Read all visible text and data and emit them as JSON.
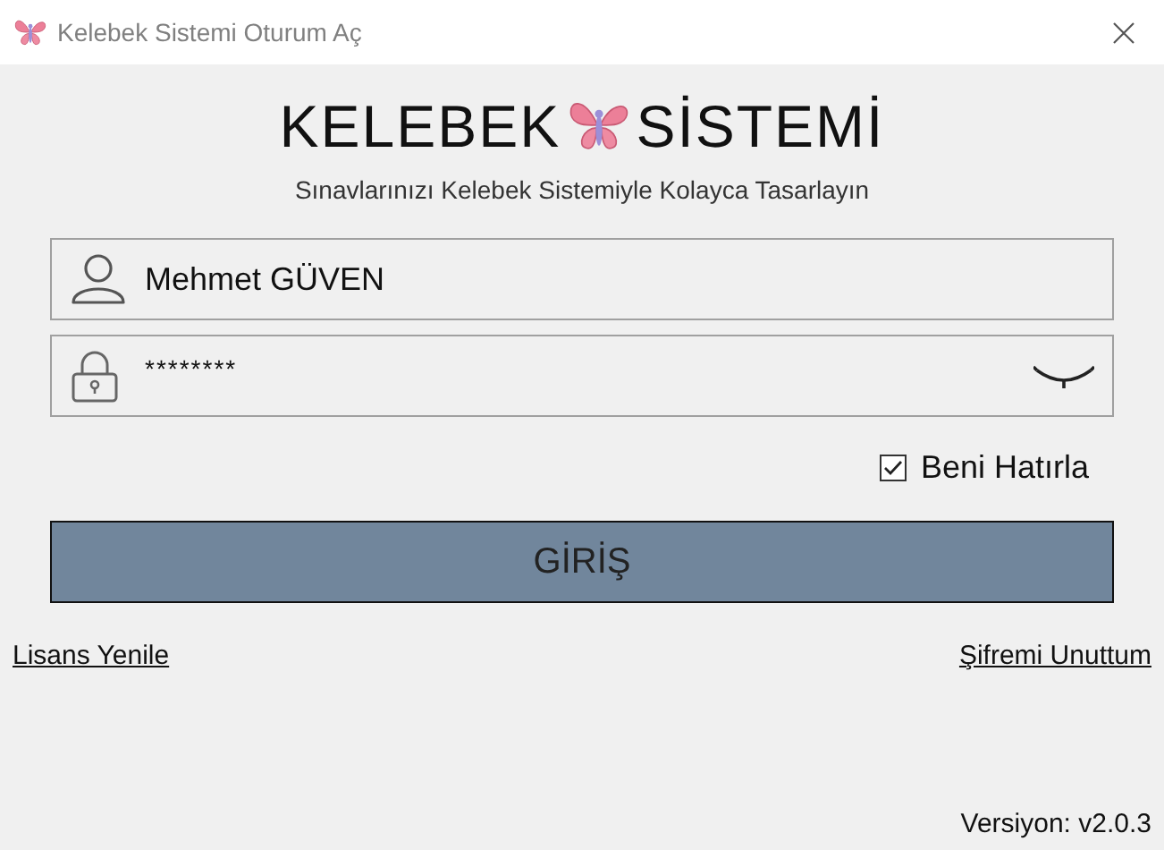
{
  "window": {
    "title": "Kelebek Sistemi Oturum Aç"
  },
  "logo": {
    "left": "KELEBEK",
    "right": "SİSTEMİ"
  },
  "subtitle": "Sınavlarınızı Kelebek Sistemiyle Kolayca Tasarlayın",
  "username": {
    "value": "Mehmet GÜVEN"
  },
  "password": {
    "value": "********",
    "revealed": false
  },
  "remember": {
    "label": "Beni Hatırla",
    "checked": true
  },
  "login_button": "GİRİŞ",
  "links": [
    "Lisans Yenile",
    "Şifremi Unuttum"
  ],
  "version": "Versiyon: v2.0.3"
}
